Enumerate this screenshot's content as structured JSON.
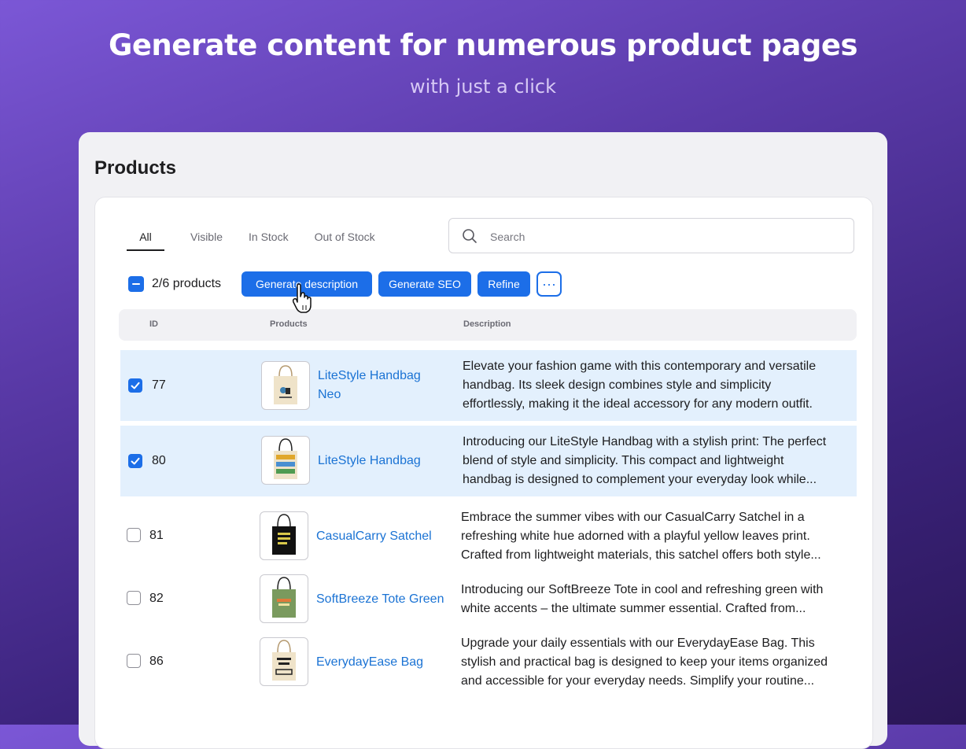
{
  "hero": {
    "title": "Generate content for numerous product pages",
    "subtitle": "with just a click"
  },
  "page": {
    "title": "Products"
  },
  "tabs": [
    {
      "label": "All",
      "active": true
    },
    {
      "label": "Visible",
      "active": false
    },
    {
      "label": "In Stock",
      "active": false
    },
    {
      "label": "Out of Stock",
      "active": false
    }
  ],
  "search": {
    "placeholder": "Search",
    "icon": "search-icon"
  },
  "bulk": {
    "count_label": "2/6 products",
    "generate_description": "Generate description",
    "generate_seo": "Generate SEO",
    "refine": "Refine",
    "more_label": "···"
  },
  "table": {
    "headers": {
      "id": "ID",
      "products": "Products",
      "description": "Description"
    },
    "rows": [
      {
        "id": "77",
        "name_line1": "LiteStyle Handbag",
        "name_line2": "Neo",
        "checked": true,
        "desc1": "Elevate your fashion game with this contemporary and versatile",
        "desc2": "handbag. Its sleek design combines style and simplicity",
        "desc3": "effortlessly, making it the ideal accessory for any modern outfit."
      },
      {
        "id": "80",
        "name_line1": "LiteStyle Handbag",
        "name_line2": "",
        "checked": true,
        "desc1": "Introducing our LiteStyle Handbag with a stylish print: The perfect",
        "desc2": "blend of style and simplicity. This compact and lightweight",
        "desc3": "handbag is designed to complement your everyday look while..."
      },
      {
        "id": "81",
        "name_line1": "CasualCarry Satchel",
        "name_line2": "",
        "checked": false,
        "desc1": "Embrace the summer vibes with our CasualCarry Satchel in a",
        "desc2": "refreshing white hue adorned with a playful yellow leaves print.",
        "desc3": "Crafted from lightweight materials, this satchel offers both style..."
      },
      {
        "id": "82",
        "name_line1": "SoftBreeze Tote Green",
        "name_line2": "",
        "checked": false,
        "desc1": "Introducing our SoftBreeze Tote in cool and refreshing green with",
        "desc2": "white accents – the ultimate summer essential. Crafted from...",
        "desc3": ""
      },
      {
        "id": "86",
        "name_line1": "EverydayEase Bag",
        "name_line2": "",
        "checked": false,
        "desc1": "Upgrade your daily essentials with our EverydayEase Bag. This",
        "desc2": "stylish and practical bag is designed to keep your items organized",
        "desc3": "and accessible for your everyday needs. Simplify your routine..."
      }
    ]
  },
  "colors": {
    "accent": "#1c6ee8",
    "link": "#1b73d4",
    "selected_row": "#e3f0fd"
  }
}
